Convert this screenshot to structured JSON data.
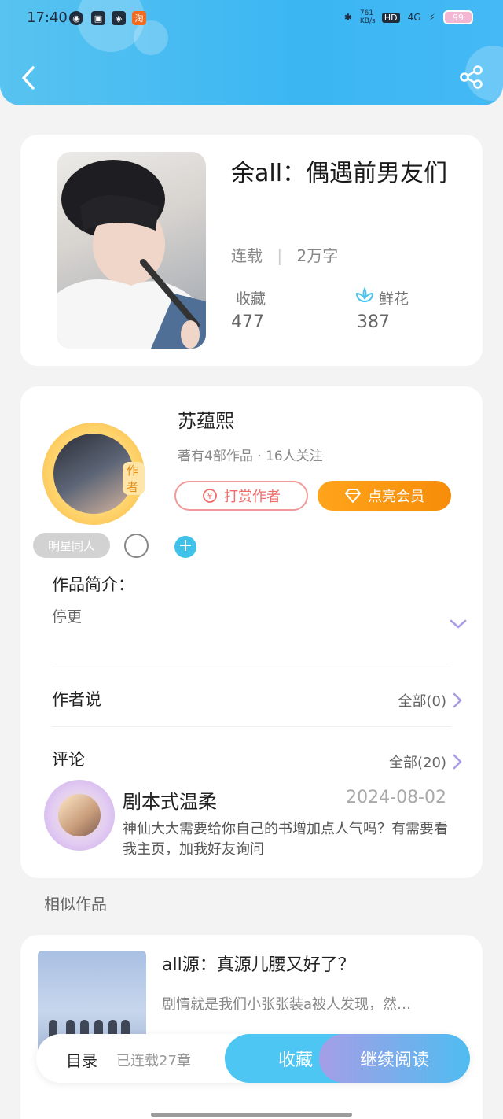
{
  "status_bar": {
    "time": "17:40",
    "app_icons": [
      "globe-icon",
      "bilibili-icon",
      "app-icon",
      "taobao-icon"
    ],
    "taobao_char": "淘",
    "net_speed": "761 KB/s",
    "hd": "HD",
    "network": "4G",
    "battery": "99"
  },
  "header": {
    "back_icon": "chevron-left-icon",
    "share_icon": "share-icon"
  },
  "book": {
    "title": "余all：偶遇前男友们",
    "status": "连载",
    "word_count": "2万字",
    "collect_label": "收藏",
    "collect_value": "477",
    "flower_label": "鲜花",
    "flower_value": "387"
  },
  "author": {
    "name": "苏蕴熙",
    "tag": "作者",
    "meta": "著有4部作品 · 16人关注",
    "tip_label": "打赏作者",
    "vip_label": "点亮会员",
    "category_tag": "明星同人"
  },
  "intro": {
    "label": "作品简介：",
    "text": "停更"
  },
  "author_says": {
    "label": "作者说",
    "count_label": "全部(0)"
  },
  "comments": {
    "label": "评论",
    "count_label": "全部(20)",
    "items": [
      {
        "user": "剧本式温柔",
        "date": "2024-08-02",
        "text": "神仙大大需要给你自己的书增加点人气吗？有需要看我主页，加我好友询问"
      }
    ]
  },
  "similar": {
    "heading": "相似作品",
    "items": [
      {
        "title": "all源：真源儿腰又好了？",
        "desc": "剧情就是我们小张张装a被人发现，然…"
      }
    ]
  },
  "bottom_bar": {
    "toc_label": "目录",
    "toc_count": "已连载27章",
    "collect_label": "收藏",
    "read_label": "继续阅读"
  },
  "colors": {
    "header": "#3bb6f3",
    "vip": "#f78c09",
    "tip": "#f06a6a",
    "accent_purple": "#a99ee6",
    "plus": "#3ec2ea"
  }
}
